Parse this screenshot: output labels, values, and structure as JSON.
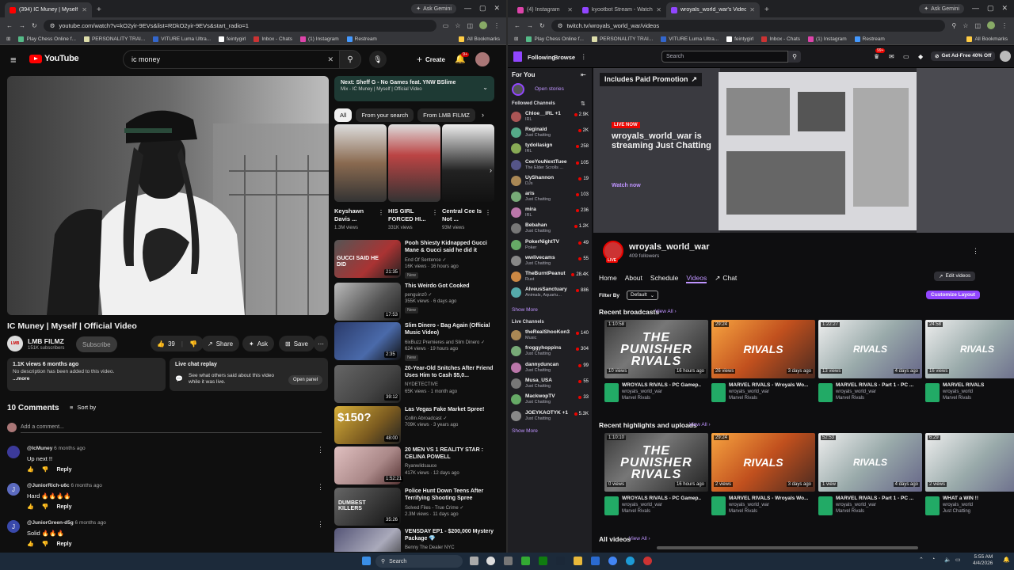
{
  "left_browser": {
    "tabs": [
      {
        "label": "(394) IC Muney | Myself | Offici..."
      }
    ],
    "ask": "Ask Gemini",
    "url": "youtube.com/watch?v=kO2yir-9EVs&list=RDkO2yir-9EVs&start_radio=1",
    "bookmarks": [
      "Play Chess Online f...",
      "PERSONALITY TRAI...",
      "VITURE Luma Ultra...",
      "feintygirl",
      "Inbox - Chats",
      "(1) Instagram",
      "Restream"
    ],
    "all_bookmarks": "All Bookmarks"
  },
  "right_browser": {
    "tabs": [
      {
        "label": "(4) Instagram"
      },
      {
        "label": "kyootbot Stream - Watch Live ..."
      },
      {
        "label": "wroyals_world_war's Videos - T..."
      }
    ],
    "ask": "Ask Gemini",
    "url": "twitch.tv/wroyals_world_war/videos",
    "bookmarks": [
      "Play Chess Online f...",
      "PERSONALITY TRAI...",
      "VITURE Luma Ultra...",
      "feintygirl",
      "Inbox - Chats",
      "(1) Instagram",
      "Restream"
    ],
    "all_bookmarks": "All Bookmarks"
  },
  "youtube": {
    "search_value": "ic money",
    "create": "Create",
    "notif_count": "9+",
    "video_title": "IC Muney | Myself | Official Video",
    "channel": "LMB FILMZ",
    "subs": "151K subscribers",
    "subscribe": "Subscribe",
    "likes": "39",
    "share": "Share",
    "ask": "Ask",
    "save": "Save",
    "desc_stats": "1.1K views  6 months ago",
    "desc_text": "No description has been added to this video.",
    "desc_more": "...more",
    "live_chat_title": "Live chat replay",
    "live_chat_text": "See what others said about this video while it was live.",
    "open_panel": "Open panel",
    "comments_count": "10 Comments",
    "sort_by": "Sort by",
    "add_comment": "Add a comment...",
    "comments": [
      {
        "user": "@IcMuney",
        "time": "6 months ago",
        "text": "Up next !!"
      },
      {
        "user": "@JuniorRich-u6c",
        "time": "6 months ago",
        "text": "Hard 🔥🔥🔥🔥"
      },
      {
        "user": "@JuniorGreen-d5g",
        "time": "6 months ago",
        "text": "Solid 🔥🔥🔥"
      }
    ],
    "reply": "Reply",
    "next_title": "Next: Sheff G - No Games feat. YNW BSlime",
    "next_sub": "Mix - IC Muney | Myself | Official Video",
    "chips": [
      "All",
      "From your search",
      "From LMB FILMZ"
    ],
    "shorts": [
      {
        "title": "Keyshawn Davis ...",
        "views": "1.3M views"
      },
      {
        "title": "HIS GIRL FORCED HI...",
        "views": "331K views"
      },
      {
        "title": "Central Cee Is Not ...",
        "views": "93M views"
      }
    ],
    "recs": [
      {
        "title": "Pooh Shiesty Kidnapped Gucci Mane & Gucci said he did it",
        "channel": "End Of Sentence ✓",
        "meta": "16K views · 16 hours ago",
        "new": "New",
        "dur": "21:35"
      },
      {
        "title": "This Weirdo Got Cooked",
        "channel": "penguinz0 ✓",
        "meta": "355K views · 6 days ago",
        "new": "New",
        "dur": "17:53"
      },
      {
        "title": "Slim Dinero - Bag Again (Official Music Video)",
        "channel": "6ixBuzz Premieres and Slim Dinero ✓",
        "meta": "624 views · 19 hours ago",
        "new": "New",
        "dur": "2:35"
      },
      {
        "title": "20-Year-Old Snitches After Friend Uses Him to Cash $5,0...",
        "channel": "NYDETECTIVE",
        "meta": "65K views · 1 month ago",
        "new": "",
        "dur": "39:12"
      },
      {
        "title": "Las Vegas Fake Market Spree!",
        "channel": "Collin Abroadcast ✓",
        "meta": "709K views · 3 years ago",
        "new": "",
        "dur": "48:00"
      },
      {
        "title": "20 MEN VS 1 REALITY STAR : CELINA POWELL",
        "channel": "Ryanwildsauce",
        "meta": "417K views · 12 days ago",
        "new": "",
        "dur": "1:52:21"
      },
      {
        "title": "Police Hunt Down Teens After Terrifying Shooting Spree",
        "channel": "Solved Files - True Crime ✓",
        "meta": "2.3M views · 11 days ago",
        "new": "",
        "dur": "35:26"
      },
      {
        "title": "VENSDAY EP1 - $200,000 Mystery Package 💎",
        "channel": "Benny The Dealer NYC",
        "meta": "",
        "new": "",
        "dur": ""
      }
    ],
    "thumb_labels": [
      "GUCCI SAID HE DID",
      "$150?",
      "DUMBEST KILLERS"
    ]
  },
  "twitch": {
    "following": "Following",
    "browse": "Browse",
    "search_placeholder": "Search",
    "badge": "99+",
    "get_adfree": "Get Ad-Free 40% Off",
    "for_you": "For You",
    "open_stories": "Open stories",
    "followed_channels": "Followed Channels",
    "followed": [
      {
        "name": "Chloe__IRL +1",
        "game": "IRL",
        "viewers": "2.9K"
      },
      {
        "name": "Reginald",
        "game": "Just Chatting",
        "viewers": "2K"
      },
      {
        "name": "tydollasign",
        "game": "IRL",
        "viewers": "258"
      },
      {
        "name": "CeeYouNextTuee",
        "game": "The Elder Scrolls ...",
        "viewers": "105"
      },
      {
        "name": "UyShannon",
        "game": "DJs",
        "viewers": "19"
      },
      {
        "name": "aris",
        "game": "Just Chatting",
        "viewers": "103"
      },
      {
        "name": "mira",
        "game": "IRL",
        "viewers": "236"
      },
      {
        "name": "Bebahan",
        "game": "Just Chatting",
        "viewers": "1.2K"
      },
      {
        "name": "PokerNightTV",
        "game": "Poker",
        "viewers": "49"
      },
      {
        "name": "wwlivecams",
        "game": "Just Chatting",
        "viewers": "55"
      },
      {
        "name": "TheBurntPeanut",
        "game": "Rust",
        "viewers": "28.4K"
      },
      {
        "name": "AlveusSanctuary",
        "game": "Animals, Aquariu...",
        "viewers": "886"
      }
    ],
    "show_more": "Show More",
    "live_channels": "Live Channels",
    "live": [
      {
        "name": "theRealShooKon3",
        "game": "Music",
        "viewers": "140"
      },
      {
        "name": "froggyhoppins",
        "game": "Just Chatting",
        "viewers": "304"
      },
      {
        "name": "dannyduncan",
        "game": "Just Chatting",
        "viewers": "99"
      },
      {
        "name": "Musa_USA",
        "game": "Just Chatting",
        "viewers": "55"
      },
      {
        "name": "MackwopTV",
        "game": "Just Chatting",
        "viewers": "33"
      },
      {
        "name": "JOEYKAOTYK +1",
        "game": "Just Chatting",
        "viewers": "5.3K"
      }
    ],
    "show_more2": "Show More",
    "promo": "Includes Paid Promotion",
    "live_now": "LIVE NOW",
    "streaming_text": "wroyals_world_war is streaming Just Chatting",
    "watch_now": "Watch now",
    "channel_name": "wroyals_world_war",
    "followers": "409 followers",
    "live_tag": "LIVE",
    "nav": [
      "Home",
      "About",
      "Schedule",
      "Videos",
      "Chat"
    ],
    "edit_videos": "Edit videos",
    "filter_by": "Filter By",
    "filter_value": "Default",
    "customize": "Customize Layout",
    "recent_broadcasts": "Recent broadcasts",
    "view_all": "View All",
    "broadcasts": [
      {
        "len": "1:10:58",
        "views": "10 views",
        "age": "16 hours ago",
        "title": "WROYALS RIVALS - PC Gamep...",
        "user": "wroyals_world_war",
        "game": "Marvel Rivals",
        "art": "THE PUNISHER RIVALS"
      },
      {
        "len": "29:24",
        "views": "26 views",
        "age": "3 days ago",
        "title": "MARVEL RIVALS - Wroyals Wo...",
        "user": "wroyals_world_war",
        "game": "Marvel Rivals",
        "art": "RIVALS"
      },
      {
        "len": "1:22:27",
        "views": "13 views",
        "age": "4 days ago",
        "title": "MARVEL RIVALS - Part 1 - PC ...",
        "user": "wroyals_world_war",
        "game": "Marvel Rivals",
        "art": "RIVALS"
      },
      {
        "len": "24:58",
        "views": "16 views",
        "age": "",
        "title": "MARVEL RIVALS",
        "user": "wroyals_world",
        "game": "Marvel Rivals",
        "art": "RIVALS"
      }
    ],
    "recent_highlights": "Recent highlights and uploads",
    "view_all2": "View All",
    "highlights": [
      {
        "len": "1:10:10",
        "views": "0 views",
        "age": "16 hours ago",
        "title": "WROYALS RIVALS - PC Gamep...",
        "user": "wroyals_world_war",
        "game": "Marvel Rivals",
        "art": "THE PUNISHER RIVALS"
      },
      {
        "len": "29:24",
        "views": "2 views",
        "age": "3 days ago",
        "title": "MARVEL RIVALS - Wroyals Wo...",
        "user": "wroyals_world_war",
        "game": "Marvel Rivals",
        "art": "RIVALS"
      },
      {
        "len": "52:53",
        "views": "1 view",
        "age": "4 days ago",
        "title": "MARVEL RIVALS - Part 1 - PC ...",
        "user": "wroyals_world_war",
        "game": "Marvel Rivals",
        "art": "RIVALS"
      },
      {
        "len": "6:29",
        "views": "2 views",
        "age": "",
        "title": "WHAT a WIN !!",
        "user": "wroyals_world",
        "game": "Just Chatting",
        "art": ""
      }
    ],
    "all_videos": "All videos",
    "view_all3": "View All"
  },
  "taskbar": {
    "search": "Search",
    "time": "5:55 AM",
    "date": "4/4/2026"
  }
}
